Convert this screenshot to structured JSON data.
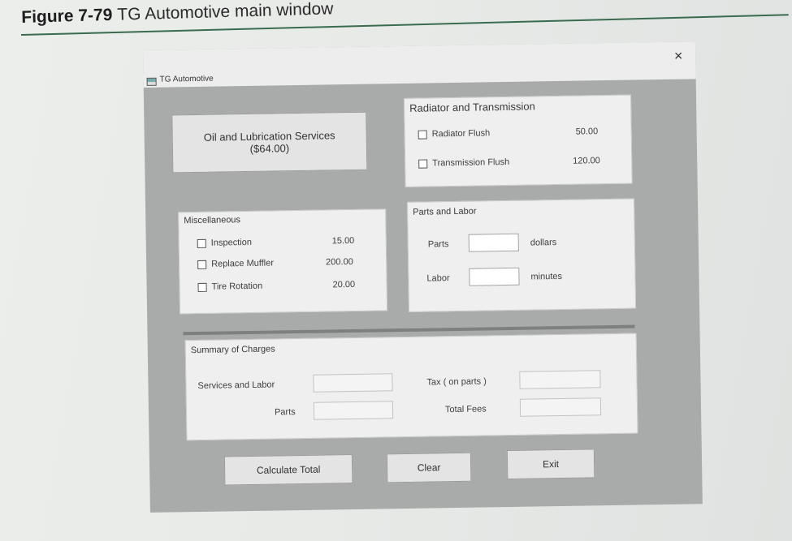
{
  "caption": {
    "figure_number": "Figure 7-79",
    "text": "TG Automotive main window"
  },
  "window": {
    "title": "TG Automotive",
    "close_glyph": "×",
    "app_icon": "app-window-icon"
  },
  "oil_button": {
    "line1": "Oil and Lubrication Services",
    "line2": "($64.00)"
  },
  "radiator_group": {
    "title": "Radiator and Transmission",
    "items": [
      {
        "label": "Radiator Flush",
        "price": "50.00"
      },
      {
        "label": "Transmission Flush",
        "price": "120.00"
      }
    ]
  },
  "misc_group": {
    "title": "Miscellaneous",
    "items": [
      {
        "label": "Inspection",
        "price": "15.00"
      },
      {
        "label": "Replace Muffler",
        "price": "200.00"
      },
      {
        "label": "Tire Rotation",
        "price": "20.00"
      }
    ]
  },
  "parts_labor_group": {
    "title": "Parts and Labor",
    "parts_label": "Parts",
    "parts_value": "",
    "parts_unit": "dollars",
    "labor_label": "Labor",
    "labor_value": "",
    "labor_unit": "minutes"
  },
  "summary_group": {
    "title": "Summary of Charges",
    "services_label": "Services and Labor",
    "parts_label": "Parts",
    "tax_label": "Tax ( on parts )",
    "total_label": "Total Fees"
  },
  "buttons": {
    "calculate": "Calculate Total",
    "clear": "Clear",
    "exit": "Exit"
  },
  "colors": {
    "window_bg": "#a9abaa",
    "panel_bg": "#eeefee",
    "caption_rule": "#3a6b4f"
  }
}
